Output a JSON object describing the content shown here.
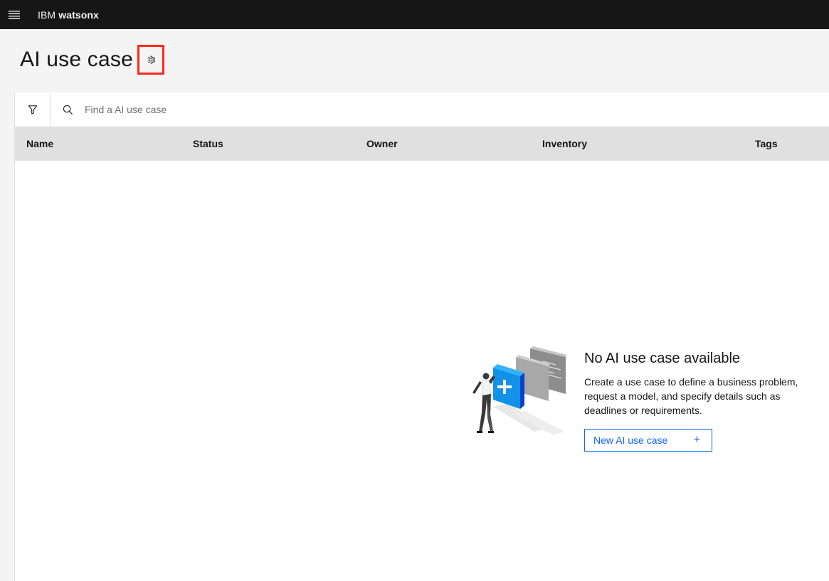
{
  "header": {
    "brand_prefix": "IBM",
    "brand_product": "watsonx"
  },
  "page": {
    "title": "AI use case"
  },
  "toolbar": {
    "search_placeholder": "Find a AI use case"
  },
  "table": {
    "columns": [
      "Name",
      "Status",
      "Owner",
      "Inventory",
      "Tags"
    ]
  },
  "empty_state": {
    "title": "No AI use case available",
    "description": "Create a use case to define a business problem, request a model, and specify details such as deadlines or requirements.",
    "button_label": "New AI use case",
    "button_icon": "+"
  },
  "colors": {
    "header_bg": "#161616",
    "accent": "#0f62fe",
    "highlight_box": "#ff2a1a"
  }
}
